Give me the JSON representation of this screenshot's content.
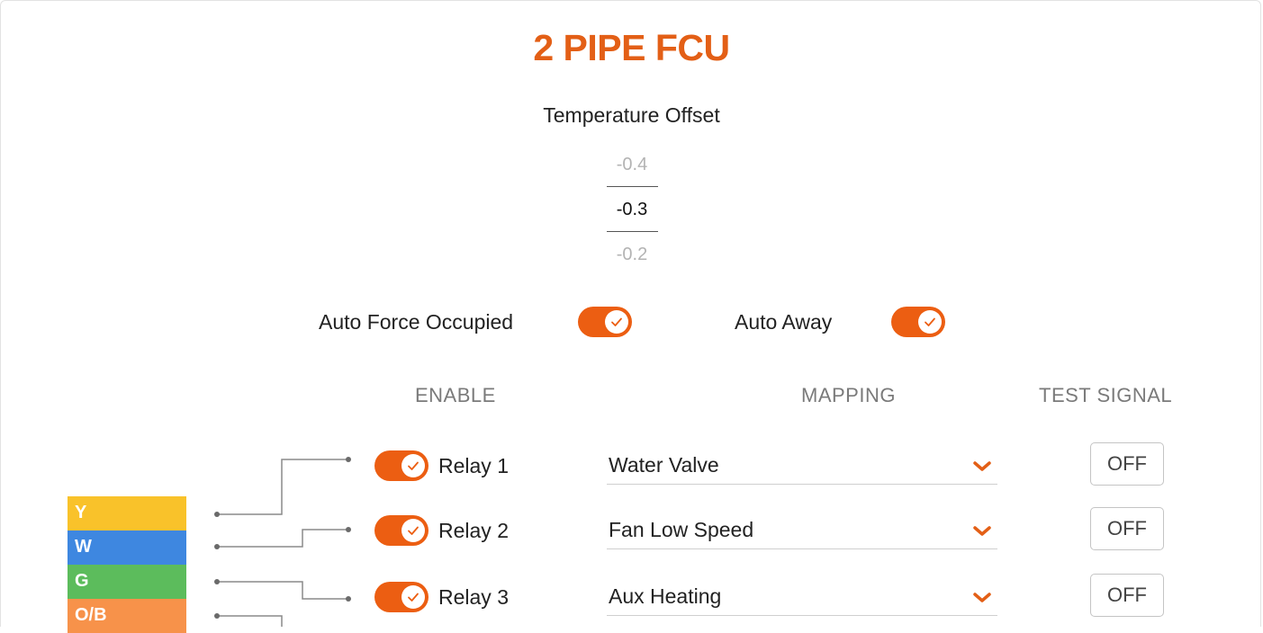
{
  "header": {
    "title": "2 PIPE FCU"
  },
  "temperature_offset": {
    "label": "Temperature Offset",
    "prev": "-0.4",
    "selected": "-0.3",
    "next": "-0.2"
  },
  "toggles": {
    "auto_force_occupied": {
      "label": "Auto Force Occupied",
      "on": true
    },
    "auto_away": {
      "label": "Auto Away",
      "on": true
    }
  },
  "columns": {
    "enable": "ENABLE",
    "mapping": "MAPPING",
    "test_signal": "TEST SIGNAL"
  },
  "relays": [
    {
      "label": "Relay 1",
      "enabled": true,
      "mapping": "Water Valve",
      "test": "OFF"
    },
    {
      "label": "Relay 2",
      "enabled": true,
      "mapping": "Fan Low Speed",
      "test": "OFF"
    },
    {
      "label": "Relay 3",
      "enabled": true,
      "mapping": "Aux Heating",
      "test": "OFF"
    }
  ],
  "wires": [
    {
      "label": "Y",
      "color": "#f9c22a"
    },
    {
      "label": "W",
      "color": "#3e87e0"
    },
    {
      "label": "G",
      "color": "#5cbc5c"
    },
    {
      "label": "O/B",
      "color": "#f7924a"
    }
  ],
  "colors": {
    "accent": "#e35f16",
    "toggle_on": "#ec5e12"
  }
}
